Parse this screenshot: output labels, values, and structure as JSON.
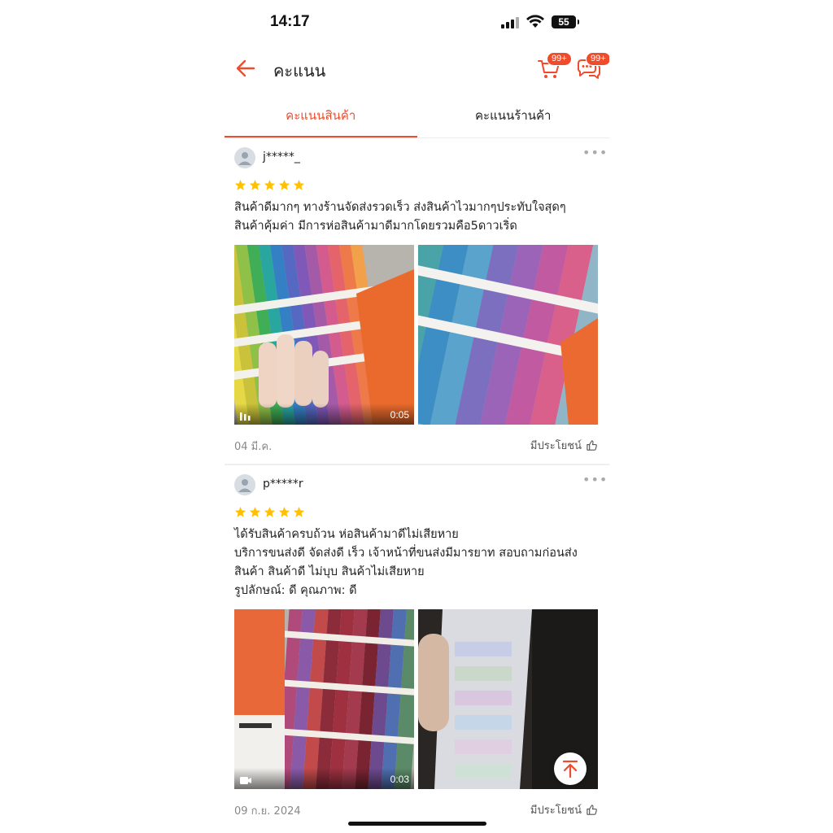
{
  "status_bar": {
    "time": "14:17",
    "battery": "55"
  },
  "header": {
    "title": "คะแนน",
    "cart_badge": "99+",
    "chat_badge": "99+"
  },
  "tabs": [
    {
      "label": "คะแนนสินค้า",
      "active": true
    },
    {
      "label": "คะแนนร้านค้า",
      "active": false
    }
  ],
  "reviews": [
    {
      "username": "j*****_",
      "rating": 5,
      "text_lines": [
        "สินค้าดีมากๆ ทางร้านจัดส่งรวดเร็ว ส่งสินค้าไวมากๆประทับใจสุดๆ",
        "สินค้าคุ้มค่า มีการห่อสินค้ามาดีมากโดยรวมคือ5ดาวเริ่ด"
      ],
      "media": [
        {
          "type": "video",
          "duration": "0:05"
        },
        {
          "type": "image"
        }
      ],
      "date": "04 มี.ค.",
      "helpful_label": "มีประโยชน์"
    },
    {
      "username": "p*****r",
      "rating": 5,
      "text_lines": [
        "ได้รับสินค้าครบถ้วน ห่อสินค้ามาดีไม่เสียหาย",
        "บริการขนส่งดี จัดส่งดี เร็ว เจ้าหน้าที่ขนส่งมีมารยาท สอบถามก่อนส่ง",
        "สินค้า สินค้าดี ไม่บุบ สินค้าไม่เสียหาย",
        "รูปลักษณ์: ดี คุณภาพ: ดี"
      ],
      "media": [
        {
          "type": "video",
          "duration": "0:03"
        },
        {
          "type": "image"
        }
      ],
      "date": "09 ก.ย. 2024",
      "helpful_label": "มีประโยชน์"
    }
  ],
  "colors": {
    "accent": "#ee4d2d",
    "star": "#ffc107"
  }
}
